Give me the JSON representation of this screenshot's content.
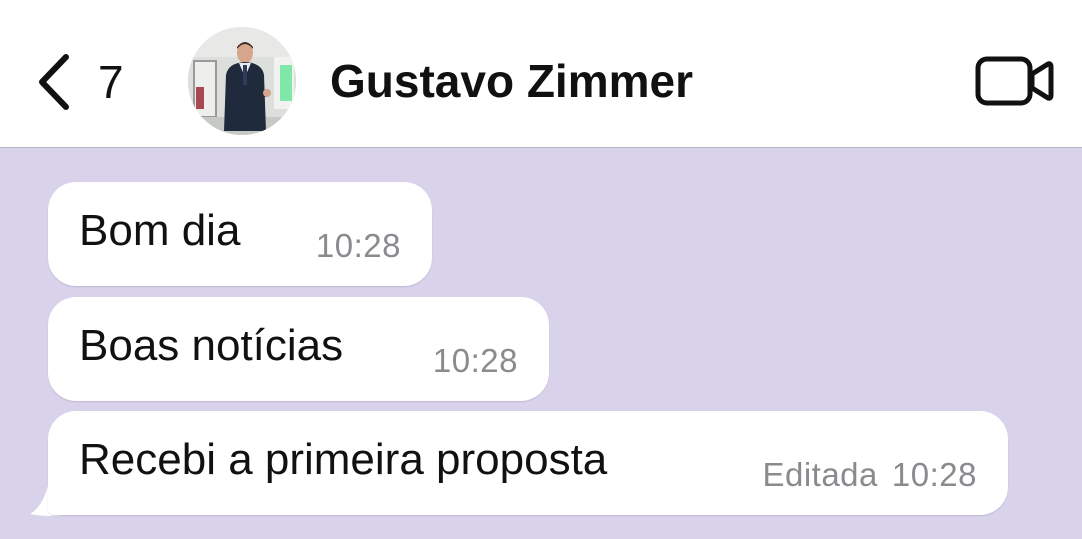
{
  "header": {
    "back_count": "7",
    "contact_name": "Gustavo Zimmer",
    "back_icon": "chevron-left-icon",
    "video_icon": "video-camera-icon"
  },
  "messages": [
    {
      "text": "Bom dia",
      "time": "10:28",
      "edited_label": ""
    },
    {
      "text": "Boas notícias",
      "time": "10:28",
      "edited_label": ""
    },
    {
      "text": "Recebi a primeira proposta",
      "time": "10:28",
      "edited_label": "Editada"
    }
  ],
  "colors": {
    "chat_background": "#d8d2ea",
    "bubble": "#ffffff",
    "header": "#ffffff",
    "timestamp": "#8a8a8f"
  }
}
